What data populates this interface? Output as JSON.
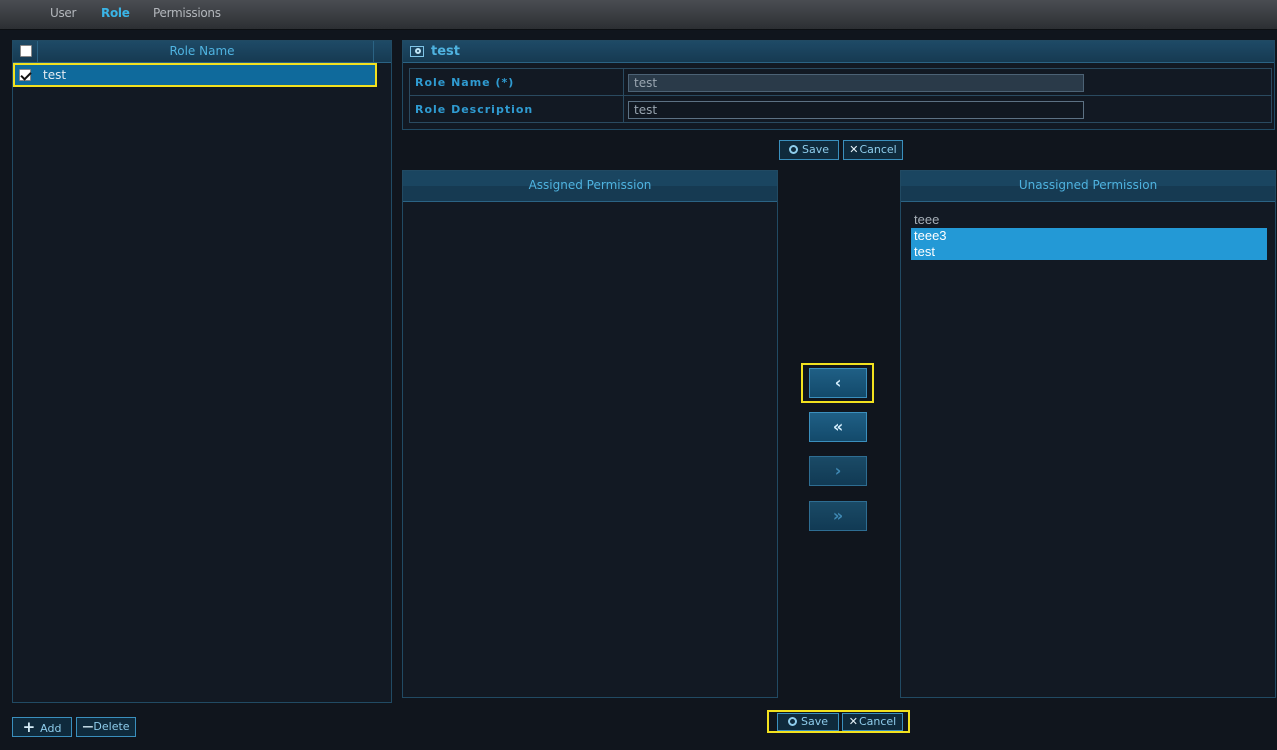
{
  "nav": {
    "tabs": [
      {
        "label": "User"
      },
      {
        "label": "Role"
      },
      {
        "label": "Permissions"
      }
    ]
  },
  "role_grid": {
    "header": "Role Name",
    "rows": [
      {
        "name": "test",
        "checked": true
      }
    ],
    "add_label": "Add",
    "delete_label": "Delete"
  },
  "detail": {
    "title": "test",
    "role_name_label": "Role Name (*)",
    "role_name_value": "test",
    "role_desc_label": "Role Description",
    "role_desc_value": "test",
    "save_label": "Save",
    "cancel_label": "Cancel"
  },
  "assigned": {
    "header": "Assigned Permission",
    "items": []
  },
  "unassigned": {
    "header": "Unassigned Permission",
    "items": [
      {
        "label": "teee",
        "selected": false
      },
      {
        "label": "teee3",
        "selected": true
      },
      {
        "label": "test",
        "selected": true
      }
    ]
  },
  "move_buttons": {
    "add_one": "‹",
    "add_all": "«",
    "remove_one": "›",
    "remove_all": "»"
  },
  "footer": {
    "save_label": "Save",
    "cancel_label": "Cancel"
  },
  "colors": {
    "accent": "#2f9bd1",
    "highlight": "#f2e11f",
    "selection": "#2399d6"
  }
}
